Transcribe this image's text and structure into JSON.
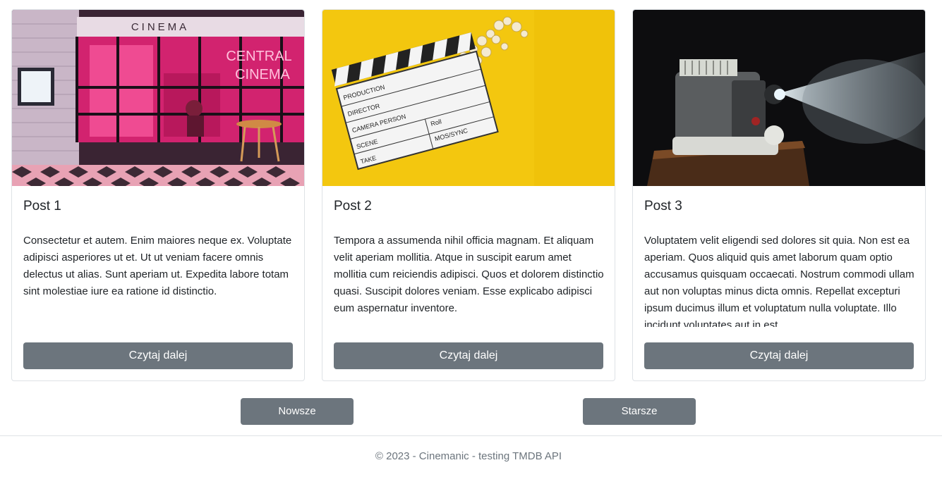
{
  "posts": [
    {
      "title": "Post 1",
      "image": "cinema-storefront-photo",
      "image_sign_top": "CINEMA",
      "image_sign_neon_1": "CENTRAL",
      "image_sign_neon_2": "CINEMA",
      "excerpt": "Consectetur et autem. Enim maiores neque ex. Voluptate adipisci asperiores ut et. Ut ut veniam facere omnis delectus ut alias. Sunt aperiam ut. Expedita labore totam sint molestiae iure ea ratione id distinctio.",
      "button_label": "Czytaj dalej"
    },
    {
      "title": "Post 2",
      "image": "clapperboard-popcorn-photo",
      "image_board_production": "PRODUCTION",
      "image_board_director": "DIRECTOR",
      "image_board_camera": "CAMERA PERSON",
      "image_board_scene": "SCENE",
      "image_board_take": "TAKE",
      "image_board_roll": "Roll",
      "image_board_mos": "MOS/SYNC",
      "excerpt": "Tempora a assumenda nihil officia magnam. Et aliquam velit aperiam mollitia. Atque in suscipit earum amet mollitia cum reiciendis adipisci. Quos et dolorem distinctio quasi. Suscipit dolores veniam. Esse explicabo adipisci eum aspernatur inventore.",
      "button_label": "Czytaj dalej"
    },
    {
      "title": "Post 3",
      "image": "film-projector-photo",
      "excerpt": "Voluptatem velit eligendi sed dolores sit quia. Non est ea aperiam. Quos aliquid quis amet laborum quam optio accusamus quisquam occaecati. Nostrum commodi ullam aut non voluptas minus dicta omnis. Repellat excepturi ipsum ducimus illum et voluptatum nulla voluptate. Illo incidunt voluptates aut in est.",
      "button_label": "Czytaj dalej"
    }
  ],
  "pagination": {
    "newer_label": "Nowsze",
    "older_label": "Starsze"
  },
  "footer": {
    "text": "© 2023 - Cinemanic - testing TMDB API"
  },
  "colors": {
    "button": "#6c757d",
    "border": "#dee2e6",
    "muted_text": "#6c757d"
  }
}
